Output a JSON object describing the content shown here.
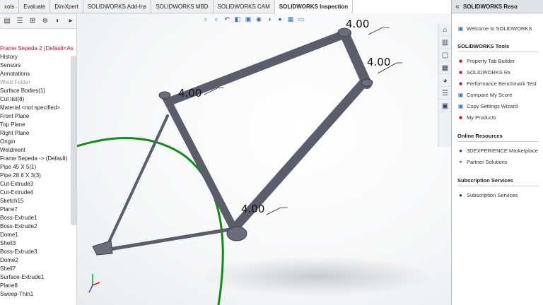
{
  "tabs": [
    "xols",
    "Evaluate",
    "DimXpert",
    "SOLIDWORKS Add-Ins",
    "SOLIDWORKS MBD",
    "SOLIDWORKS CAM",
    "SOLIDWORKS Inspection"
  ],
  "active_tab": "SOLIDWORKS Inspection",
  "feature_tree": {
    "root": "Frame Sepeda 2  (Default<As",
    "items": [
      "History",
      "Sensors",
      "Annotations",
      "Weld Folder",
      "Surface Bodies(1)",
      "Cut list(8)",
      "Material <not specified>",
      "Front Plane",
      "Top Plane",
      "Right Plane",
      "Origin",
      "Weldment",
      "Frame Sepeda -> (Default)",
      "Pipe 45 X 5(1)",
      "Pipe 28.6 X 3(3)",
      "Cut-Extrude3",
      "Cut-Extrude4",
      "Sketch15",
      "Plane7",
      "Boss-Extrude1",
      "Boss-Extrude2",
      "Dome1",
      "Shell3",
      "Boss-Extrude3",
      "Dome2",
      "Shell7",
      "Surface-Extrude1",
      "Plane8",
      "Sweep-Thin1"
    ]
  },
  "dimensions": [
    "4.00",
    "4.00",
    "4.00",
    "4.00"
  ],
  "resources": {
    "header": "SOLIDWORKS Reso",
    "welcome": "Welcome to SOLIDWORKS",
    "tools_title": "SOLIDWORKS Tools",
    "tools": [
      "Property Tab Builder",
      "SOLIDWORKS Rx",
      "Performance Benchmark Test",
      "Compare My Score",
      "Copy Settings Wizard",
      "My Products"
    ],
    "online_title": "Online Resources",
    "online": [
      "3DEXPERIENCE Marketplace",
      "Partner Solutions"
    ],
    "subs_title": "Subscription Services",
    "subs": [
      "Subscription Services"
    ]
  },
  "colors": {
    "frame": "#5b5e6a",
    "wheel": "#138a1a",
    "active_tab": "#ffffff",
    "root_item": "#c8102e"
  }
}
